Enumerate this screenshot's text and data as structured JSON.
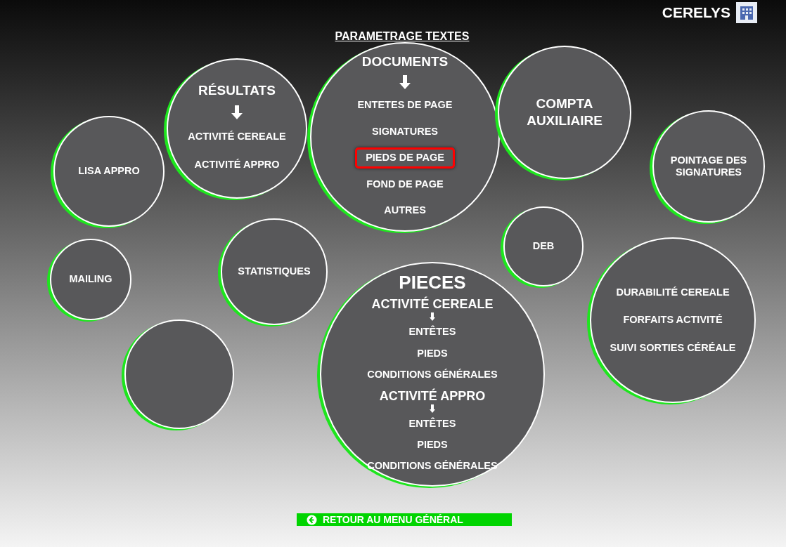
{
  "brand": {
    "name": "CERELYS"
  },
  "page_title": "PARAMETRAGE TEXTES",
  "circles": [
    {
      "kind": "bubble",
      "lines": [
        {
          "kind": "link",
          "text": "LISA APPRO",
          "selected": false
        }
      ]
    },
    {
      "kind": "bubble",
      "lines": [
        {
          "kind": "title",
          "text": "RÉSULTATS"
        },
        {
          "kind": "arrow"
        },
        {
          "kind": "link",
          "text": "ACTIVITÉ CEREALE",
          "selected": false
        },
        {
          "kind": "link",
          "text": "ACTIVITÉ APPRO",
          "selected": false
        }
      ]
    },
    {
      "kind": "bubble",
      "lines": [
        {
          "kind": "title",
          "text": "DOCUMENTS"
        },
        {
          "kind": "arrow"
        },
        {
          "kind": "link",
          "text": "ENTETES DE PAGE",
          "selected": false
        },
        {
          "kind": "link",
          "text": "SIGNATURES",
          "selected": false
        },
        {
          "kind": "link",
          "text": "PIEDS DE PAGE",
          "selected": true
        },
        {
          "kind": "link",
          "text": "FOND DE PAGE",
          "selected": false
        },
        {
          "kind": "link",
          "text": "AUTRES",
          "selected": false
        }
      ]
    },
    {
      "kind": "bubble",
      "lines": [
        {
          "kind": "title",
          "text": "COMPTA AUXILIAIRE"
        }
      ]
    },
    {
      "kind": "bubble",
      "lines": [
        {
          "kind": "link",
          "text": "POINTAGE DES SIGNATURES",
          "selected": false
        }
      ]
    },
    {
      "kind": "bubble",
      "lines": [
        {
          "kind": "link",
          "text": "MAILING",
          "selected": false
        }
      ]
    },
    {
      "kind": "bubble",
      "lines": [
        {
          "kind": "link",
          "text": "STATISTIQUES",
          "selected": false
        }
      ]
    },
    {
      "kind": "blank"
    },
    {
      "kind": "bubble",
      "lines": [
        {
          "kind": "link",
          "text": "DEB",
          "selected": false
        }
      ]
    },
    {
      "kind": "bubble",
      "lines": [
        {
          "kind": "heading",
          "text": "PIECES"
        },
        {
          "kind": "subtitle",
          "text": "ACTIVITÉ CEREALE"
        },
        {
          "kind": "small-arrow"
        },
        {
          "kind": "link",
          "text": "ENTÊTES",
          "selected": false
        },
        {
          "kind": "link",
          "text": "PIEDS",
          "selected": false
        },
        {
          "kind": "link",
          "text": "CONDITIONS GÉNÉRALES",
          "selected": false
        },
        {
          "kind": "subtitle",
          "text": "ACTIVITÉ APPRO"
        },
        {
          "kind": "small-arrow"
        },
        {
          "kind": "link",
          "text": "ENTÊTES",
          "selected": false
        },
        {
          "kind": "link",
          "text": "PIEDS",
          "selected": false
        },
        {
          "kind": "link",
          "text": "CONDITIONS GÉNÉRALES",
          "selected": false
        }
      ]
    },
    {
      "kind": "bubble",
      "lines": [
        {
          "kind": "link",
          "text": "DURABILITÉ CEREALE",
          "selected": false
        },
        {
          "kind": "link",
          "text": "FORFAITS ACTIVITÉ",
          "selected": false
        },
        {
          "kind": "link",
          "text": "SUIVI SORTIES CÉRÉALE",
          "selected": false
        }
      ]
    }
  ],
  "back_button": {
    "label": "RETOUR AU MENU GÉNÉRAL"
  }
}
